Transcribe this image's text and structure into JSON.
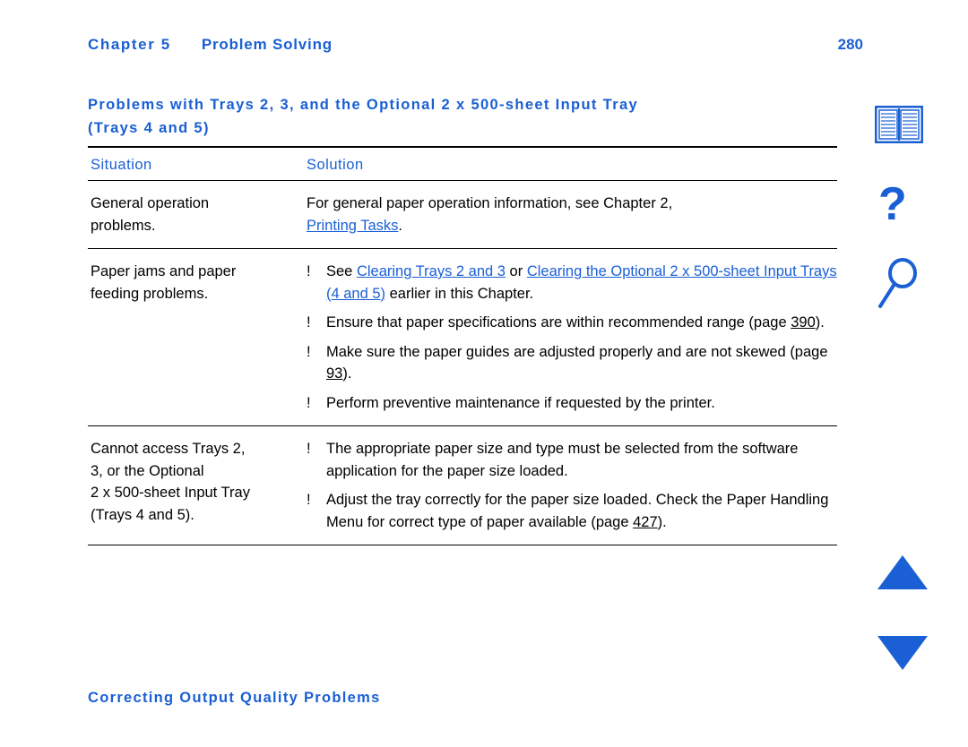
{
  "header": {
    "chapter_label": "Chapter 5",
    "chapter_title": "Problem Solving",
    "page_number": "280"
  },
  "section": {
    "heading_line1": "Problems with Trays 2, 3, and the Optional 2 x 500-sheet Input Tray",
    "heading_line2": "(Trays 4 and 5)"
  },
  "table": {
    "headers": {
      "situation": "Situation",
      "solution": "Solution"
    },
    "rows": [
      {
        "situation_line1": "General operation",
        "situation_line2": "problems.",
        "solution": {
          "line1": "For general paper operation information, see Chapter 2,",
          "link": "Printing Tasks",
          "after_link": "."
        }
      },
      {
        "situation_line1": "Paper jams and paper",
        "situation_line2": "feeding problems.",
        "bullets": [
          {
            "marker": "!",
            "pre": "See ",
            "link1": "Clearing Trays 2 and 3",
            "mid": " or ",
            "link2": "Clearing the Optional ",
            "link3": "2 x 500-sheet Input Trays (4 and 5)",
            "post": " earlier in this Chapter."
          },
          {
            "marker": "!",
            "pre": "Ensure that paper specifications are within recommended range (page ",
            "page": "390",
            "post": ")."
          },
          {
            "marker": "!",
            "pre": "Make sure the paper guides are adjusted properly and are not skewed (page ",
            "page": "93",
            "post": ")."
          },
          {
            "marker": "!",
            "pre": "Perform preventive maintenance if requested by the printer.",
            "page": "",
            "post": ""
          }
        ]
      },
      {
        "situation_line1": "Cannot access Trays 2,",
        "situation_line2": "3, or the Optional",
        "situation_line3": "2 x 500-sheet Input Tray",
        "situation_line4": "(Trays 4 and 5).",
        "bullets": [
          {
            "marker": "!",
            "pre": "The appropriate paper size and type must be selected from the software application for the paper size loaded.",
            "page": "",
            "post": ""
          },
          {
            "marker": "!",
            "pre": "Adjust the tray correctly for the paper size loaded. Check the Paper Handling Menu for correct type of paper available (page ",
            "page": "427",
            "post": ")."
          }
        ]
      }
    ]
  },
  "footer": {
    "text": "Correcting Output Quality Problems"
  },
  "rail": {
    "book_icon": "book-icon",
    "help_icon": "?",
    "search_icon": "magnifier-icon",
    "up_icon": "triangle-up-icon",
    "down_icon": "triangle-down-icon"
  },
  "colors": {
    "link_blue": "#1a5fd4",
    "text_black": "#000000",
    "rule": "#000000"
  }
}
